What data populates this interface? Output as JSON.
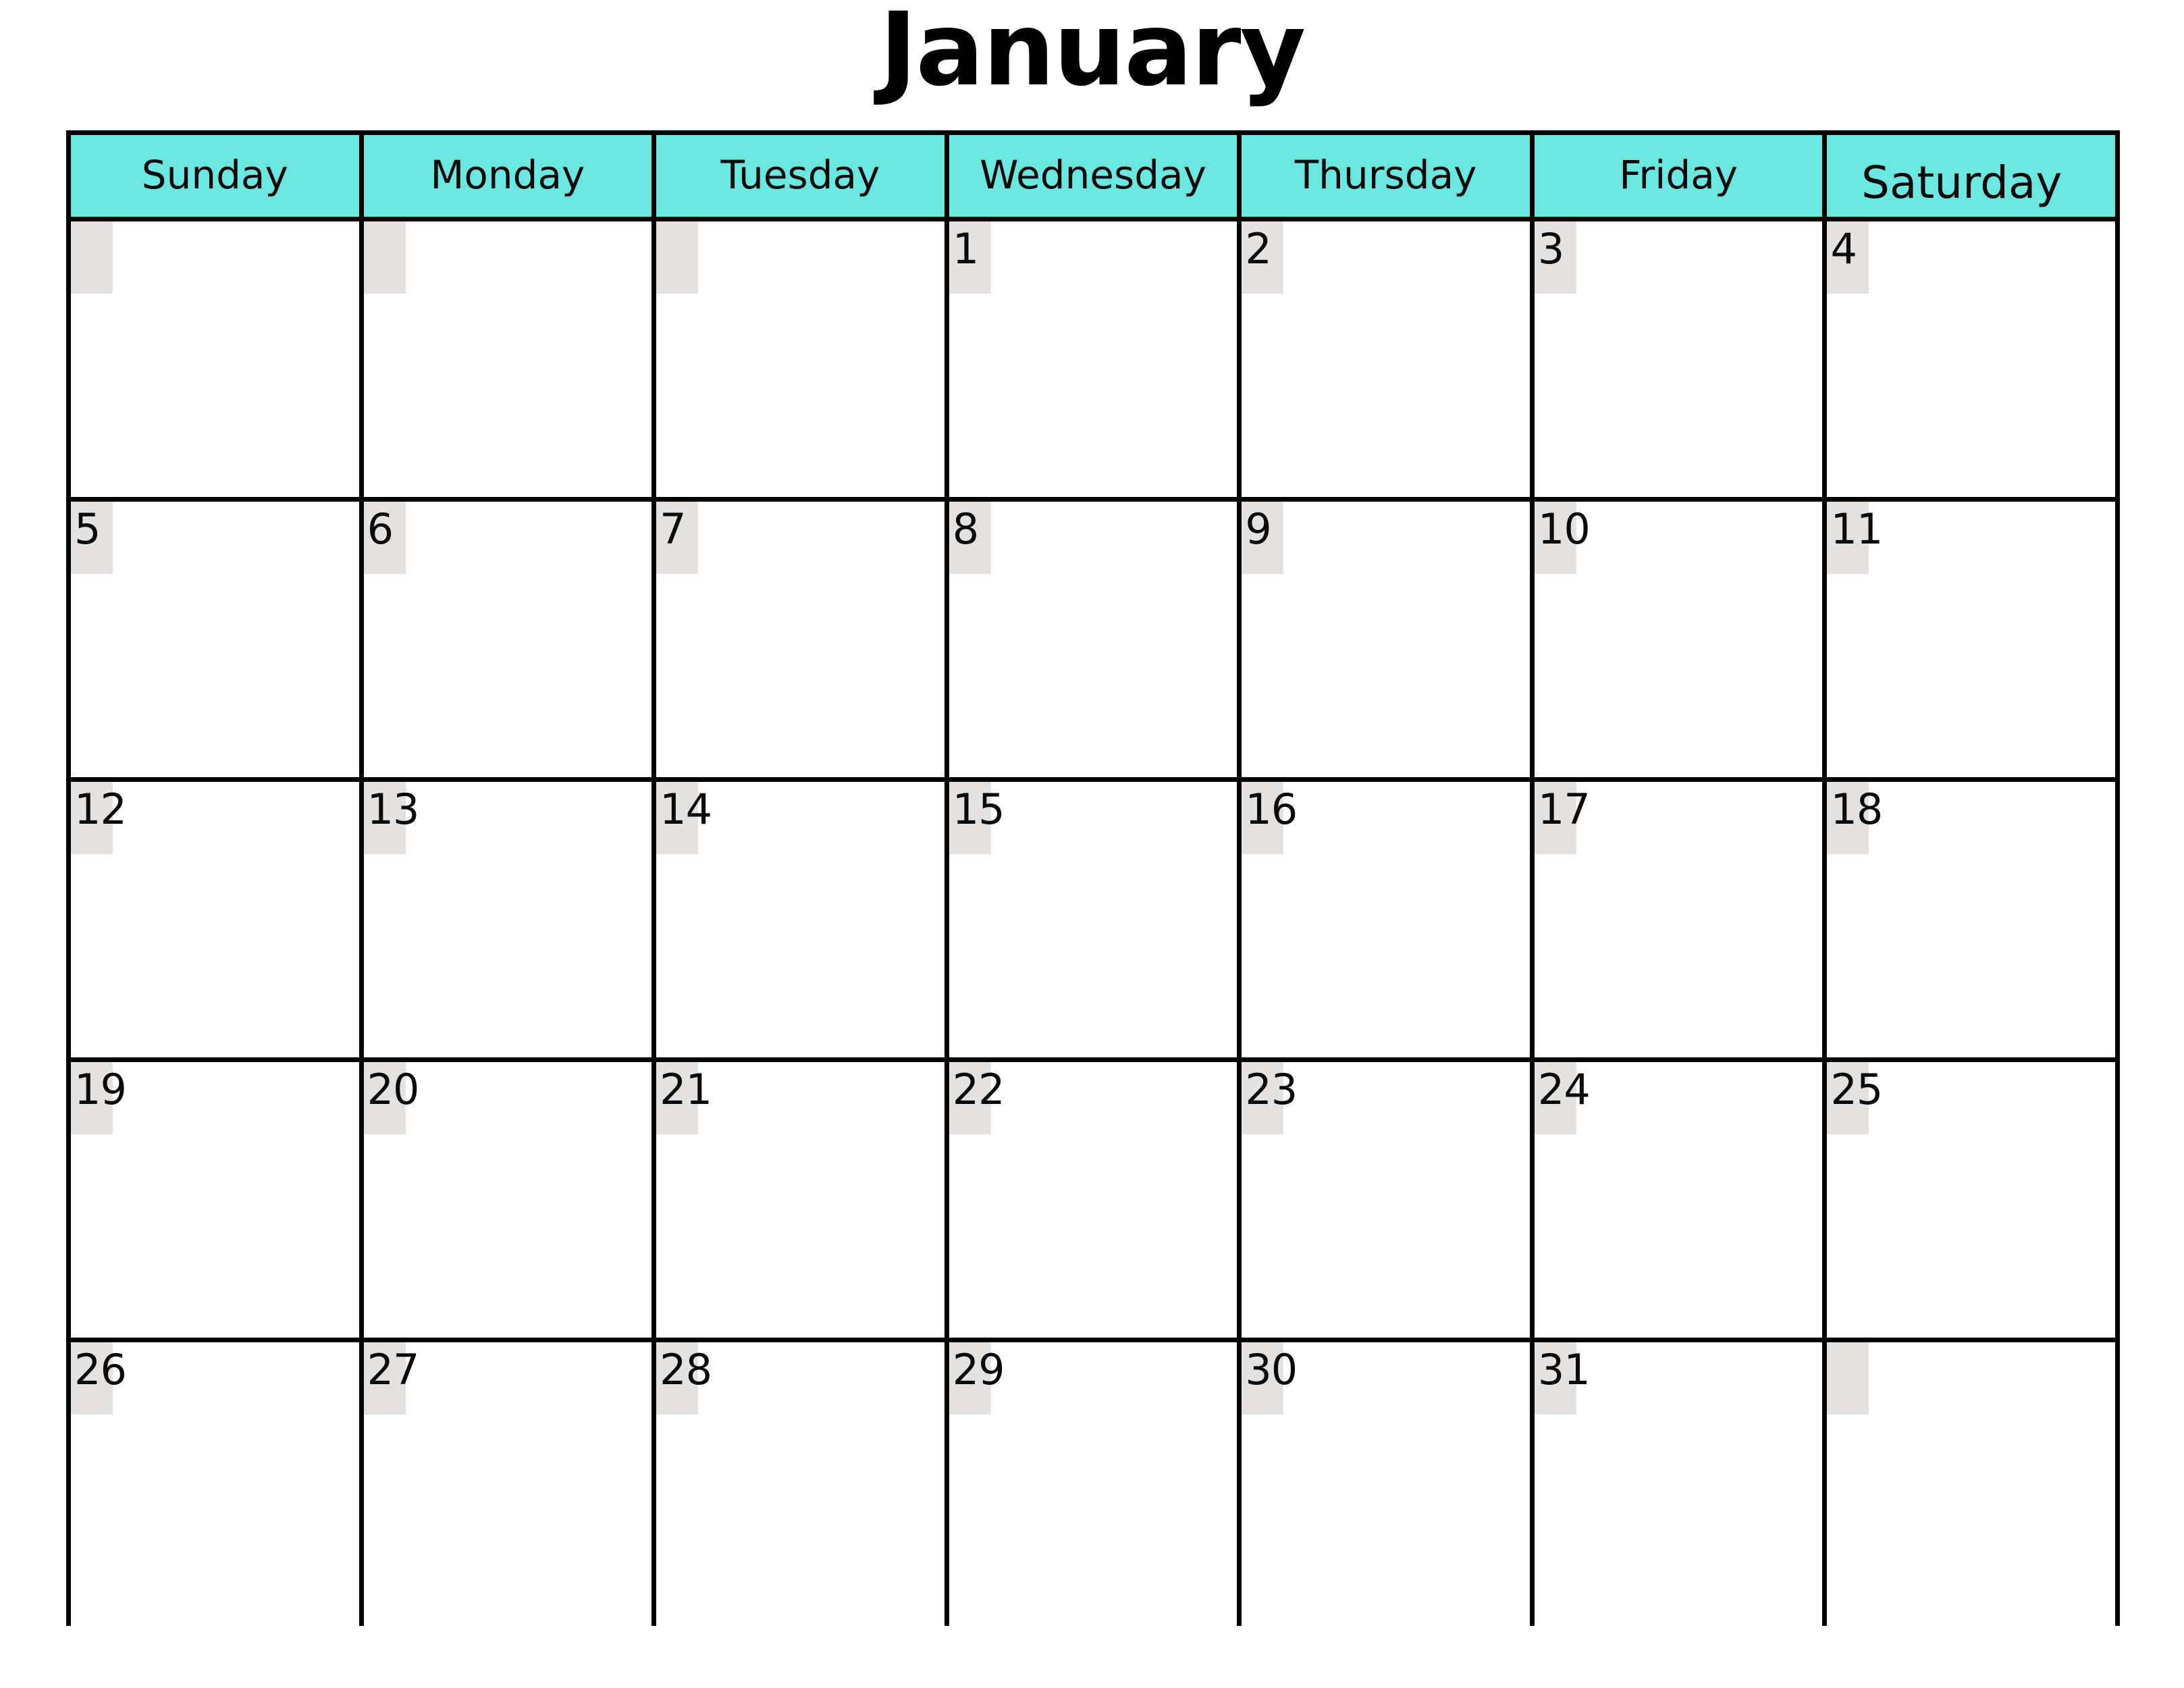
{
  "title": {
    "month": "January"
  },
  "colors": {
    "header_background": "#6BE7E0",
    "date_chip_background": "#E3E2E1",
    "grid_border": "#000000",
    "text": "#000000",
    "cell_background": "#FFFFFF"
  },
  "calendar": {
    "day_headers": [
      {
        "label": "Sunday"
      },
      {
        "label": "Monday"
      },
      {
        "label": "Tuesday"
      },
      {
        "label": "Wednesday"
      },
      {
        "label": "Thursday"
      },
      {
        "label": "Friday"
      },
      {
        "label": "Saturday"
      }
    ],
    "weeks": [
      {
        "days": [
          {
            "number": ""
          },
          {
            "number": ""
          },
          {
            "number": ""
          },
          {
            "number": "1"
          },
          {
            "number": "2"
          },
          {
            "number": "3"
          },
          {
            "number": "4"
          }
        ]
      },
      {
        "days": [
          {
            "number": "5"
          },
          {
            "number": "6"
          },
          {
            "number": "7"
          },
          {
            "number": "8"
          },
          {
            "number": "9"
          },
          {
            "number": "10"
          },
          {
            "number": "11"
          }
        ]
      },
      {
        "days": [
          {
            "number": "12"
          },
          {
            "number": "13"
          },
          {
            "number": "14"
          },
          {
            "number": "15"
          },
          {
            "number": "16"
          },
          {
            "number": "17"
          },
          {
            "number": "18"
          }
        ]
      },
      {
        "days": [
          {
            "number": "19"
          },
          {
            "number": "20"
          },
          {
            "number": "21"
          },
          {
            "number": "22"
          },
          {
            "number": "23"
          },
          {
            "number": "24"
          },
          {
            "number": "25"
          }
        ]
      },
      {
        "days": [
          {
            "number": "26"
          },
          {
            "number": "27"
          },
          {
            "number": "28"
          },
          {
            "number": "29"
          },
          {
            "number": "30"
          },
          {
            "number": "31"
          },
          {
            "number": ""
          }
        ]
      }
    ]
  }
}
